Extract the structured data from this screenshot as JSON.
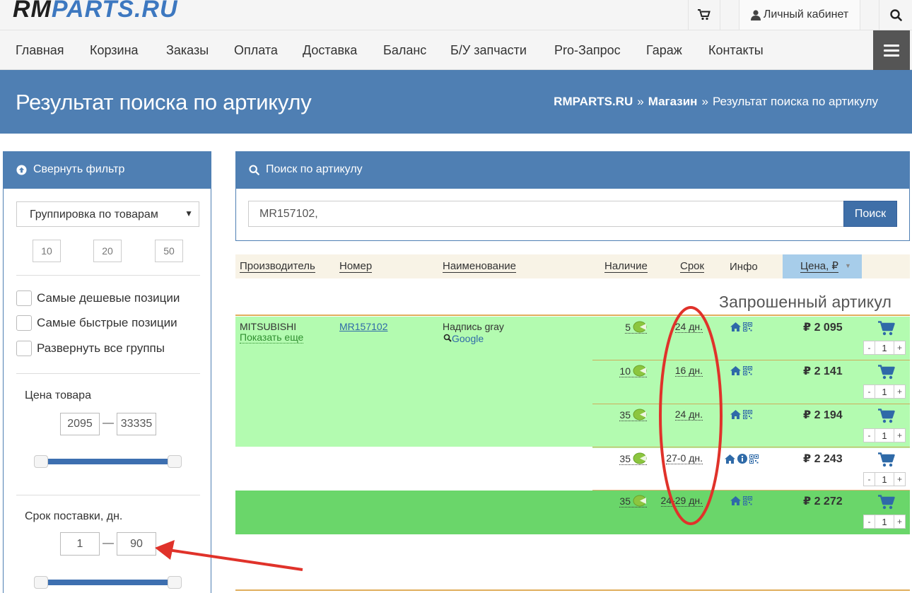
{
  "logo": {
    "rm": "RM",
    "parts": "PARTS.RU"
  },
  "topbar": {
    "account_label": "Личный кабинет"
  },
  "nav": {
    "items": [
      "Главная",
      "Корзина",
      "Заказы",
      "Оплата",
      "Доставка",
      "Баланс",
      "Б/У запчасти",
      "Pro-Запрос",
      "Гараж",
      "Контакты"
    ]
  },
  "banner": {
    "title": "Результат поиска по артикулу",
    "breadcrumb": [
      "RMPARTS.RU",
      "Магазин",
      "Результат поиска по артикулу"
    ],
    "separator": "»"
  },
  "sidebar": {
    "header": "Свернуть фильтр",
    "grouping": {
      "selected": "Группировка по товарам"
    },
    "page_sizes": [
      "10",
      "20",
      "50"
    ],
    "checkboxes": [
      "Самые дешевые позиции",
      "Самые быстрые позиции",
      "Развернуть все группы"
    ],
    "price_filter": {
      "title": "Цена товара",
      "min": "2095",
      "max": "33335",
      "dash": "—"
    },
    "delivery_filter": {
      "title": "Срок поставки, дн.",
      "min": "1",
      "max": "90",
      "dash": "—"
    }
  },
  "search": {
    "header": "Поиск по артикулу",
    "value": "MR157102,",
    "button": "Поиск"
  },
  "table": {
    "headers": {
      "manufacturer": "Производитель",
      "number": "Номер",
      "name": "Наименование",
      "stock": "Наличие",
      "term": "Срок",
      "info": "Инфо",
      "price": "Цена, ₽"
    },
    "section_title": "Запрошенный артикул",
    "product": {
      "manufacturer": "MITSUBISHI",
      "show_more": "Показать еще",
      "number": "MR157102",
      "name": "Надпись gray",
      "google": "Google"
    },
    "offers": [
      {
        "stock": "5",
        "term": "24 дн.",
        "price": "₽ 2 095",
        "qty": "1",
        "has_info": false
      },
      {
        "stock": "10",
        "term": "16 дн.",
        "price": "₽ 2 141",
        "qty": "1",
        "has_info": false
      },
      {
        "stock": "35",
        "term": "24 дн.",
        "price": "₽ 2 194",
        "qty": "1",
        "has_info": false
      },
      {
        "stock": "35",
        "term": "27-0 дн.",
        "price": "₽ 2 243",
        "qty": "1",
        "has_info": true
      },
      {
        "stock": "35",
        "term": "24-29 дн.",
        "price": "₽ 2 272",
        "qty": "1",
        "has_info": false
      }
    ],
    "stepper": {
      "minus": "-",
      "plus": "+"
    }
  },
  "colors": {
    "brand": "#4f7fb3",
    "highlight_green": "#b3fbb0",
    "dark_green": "#6ad66a",
    "annotation_red": "#e0322a"
  },
  "icons": [
    "cart-icon",
    "user-icon",
    "search-icon",
    "menu-icon",
    "arrow-up-circle-icon",
    "home-icon",
    "info-icon",
    "qr-code-icon",
    "leaf-icon",
    "magnifier-icon"
  ]
}
